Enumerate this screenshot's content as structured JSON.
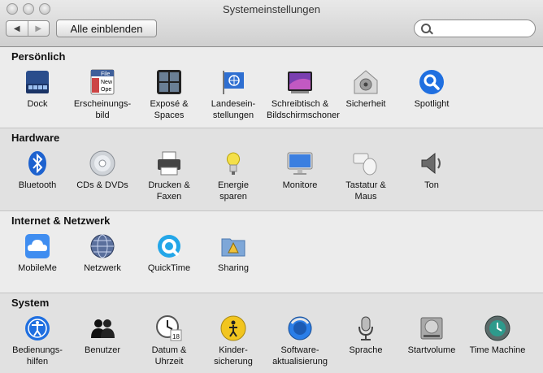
{
  "window": {
    "title": "Systemeinstellungen"
  },
  "toolbar": {
    "back_glyph": "◀",
    "forward_glyph": "▶",
    "show_all_label": "Alle einblenden",
    "search_placeholder": "",
    "search_value": ""
  },
  "sections": [
    {
      "title": "Persönlich",
      "items": [
        {
          "label": "Dock",
          "icon": "dock-icon"
        },
        {
          "label": "Erscheinungs-\nbild",
          "icon": "appearance-icon"
        },
        {
          "label": "Exposé &\nSpaces",
          "icon": "expose-spaces-icon"
        },
        {
          "label": "Landesein-\nstellungen",
          "icon": "international-icon"
        },
        {
          "label": "Schreibtisch &\nBildschirmschoner",
          "icon": "desktop-screensaver-icon"
        },
        {
          "label": "Sicherheit",
          "icon": "security-icon"
        },
        {
          "label": "Spotlight",
          "icon": "spotlight-icon"
        }
      ]
    },
    {
      "title": "Hardware",
      "items": [
        {
          "label": "Bluetooth",
          "icon": "bluetooth-icon"
        },
        {
          "label": "CDs & DVDs",
          "icon": "cd-dvd-icon"
        },
        {
          "label": "Drucken &\nFaxen",
          "icon": "printer-icon"
        },
        {
          "label": "Energie\nsparen",
          "icon": "lightbulb-icon"
        },
        {
          "label": "Monitore",
          "icon": "monitor-icon"
        },
        {
          "label": "Tastatur &\nMaus",
          "icon": "keyboard-mouse-icon"
        },
        {
          "label": "Ton",
          "icon": "speaker-icon"
        }
      ]
    },
    {
      "title": "Internet & Netzwerk",
      "items": [
        {
          "label": "MobileMe",
          "icon": "mobileme-cloud-icon"
        },
        {
          "label": "Netzwerk",
          "icon": "network-globe-icon"
        },
        {
          "label": "QuickTime",
          "icon": "quicktime-icon"
        },
        {
          "label": "Sharing",
          "icon": "sharing-folder-icon"
        }
      ]
    },
    {
      "title": "System",
      "items": [
        {
          "label": "Bedienungs-\nhilfen",
          "icon": "accessibility-icon"
        },
        {
          "label": "Benutzer",
          "icon": "users-icon"
        },
        {
          "label": "Datum &\nUhrzeit",
          "icon": "clock-calendar-icon"
        },
        {
          "label": "Kinder-\nsicherung",
          "icon": "parental-controls-icon"
        },
        {
          "label": "Software-\naktualisierung",
          "icon": "software-update-icon"
        },
        {
          "label": "Sprache",
          "icon": "microphone-icon"
        },
        {
          "label": "Startvolume",
          "icon": "startup-disk-icon"
        },
        {
          "label": "Time Machine",
          "icon": "time-machine-icon"
        }
      ]
    }
  ],
  "icon_text": {
    "appearance_tab": "File",
    "appearance_menu_1": "New",
    "appearance_menu_2": "Ope",
    "calendar_day": "18"
  }
}
